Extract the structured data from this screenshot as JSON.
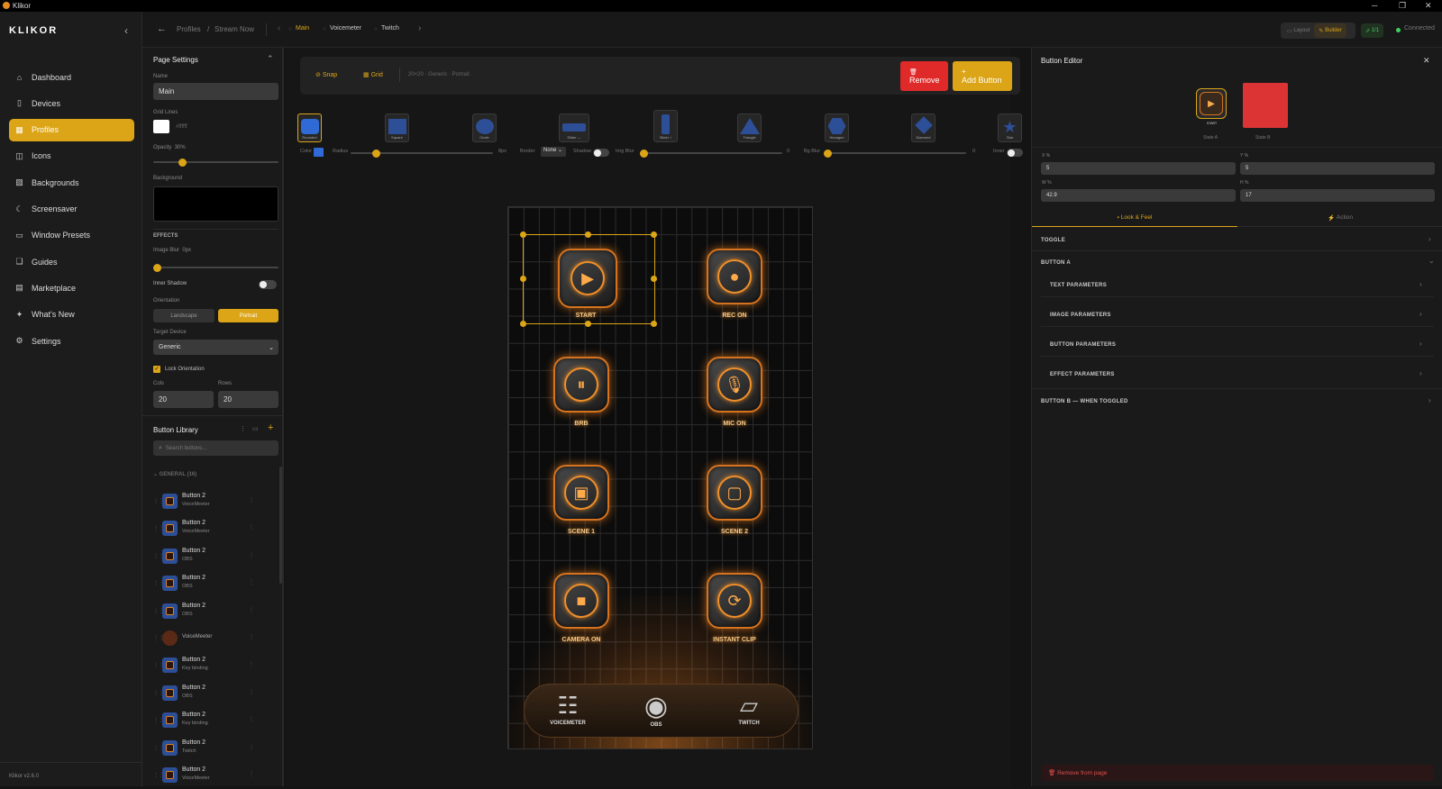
{
  "titlebar": {
    "title": "Klikor",
    "minimize": "─",
    "restore": "❐",
    "close": "✕"
  },
  "sidebar": {
    "brand": "KLIKOR",
    "collapse_icon": "‹",
    "items": [
      {
        "label": "Dashboard",
        "icon": "⌂"
      },
      {
        "label": "Devices",
        "icon": "▯"
      },
      {
        "label": "Profiles",
        "icon": "▦",
        "active": true
      },
      {
        "label": "Icons",
        "icon": "◫"
      },
      {
        "label": "Backgrounds",
        "icon": "▨"
      },
      {
        "label": "Screensaver",
        "icon": "☾"
      },
      {
        "label": "Window Presets",
        "icon": "▭"
      },
      {
        "label": "Guides",
        "icon": "❑"
      },
      {
        "label": "Marketplace",
        "icon": "▤"
      },
      {
        "label": "What's New",
        "icon": "✦"
      },
      {
        "label": "Settings",
        "icon": "⚙"
      }
    ],
    "version": "Klikor v2.6.0"
  },
  "topbar": {
    "back_icon": "←",
    "breadcrumb": [
      "Profiles",
      "/",
      "Stream Now"
    ],
    "prev_icon": "‹",
    "next_icon": "›",
    "page_tabs": [
      "Main",
      "Voicemeter",
      "Twitch"
    ],
    "mode_layout": "Layout",
    "mode_builder": "Builder",
    "page_count": "1/1",
    "status": "Connected"
  },
  "page_settings": {
    "title": "Page Settings",
    "name_label": "Name",
    "name_value": "Main",
    "grid_lines_label": "Grid Lines",
    "grid_color": "#ffffff",
    "opacity_label": "Opacity",
    "opacity_value": "30%",
    "opacity_fraction": 0.2,
    "background_label": "Background",
    "effects_label": "EFFECTS",
    "image_blur_label": "Image Blur",
    "image_blur_value": "0px",
    "inner_shadow_label": "Inner Shadow",
    "orientation_label": "Orientation",
    "landscape": "Landscape",
    "portrait": "Portrait",
    "target_device_label": "Target Device",
    "target_device_value": "Generic",
    "lock_orientation": "Lock Orientation",
    "cols_label": "Cols",
    "cols_value": "20",
    "rows_label": "Rows",
    "rows_value": "20"
  },
  "library": {
    "title": "Button Library",
    "search_placeholder": "Search buttons...",
    "group": "GENERAL (16)",
    "items": [
      {
        "name": "Button 2",
        "sub": "VoiceMeeter"
      },
      {
        "name": "Button 2",
        "sub": "VoiceMeeter"
      },
      {
        "name": "Button 2",
        "sub": "OBS"
      },
      {
        "name": "Button 2",
        "sub": "OBS"
      },
      {
        "name": "Button 2",
        "sub": "OBS"
      },
      {
        "name": "",
        "sub": "VoiceMeeter"
      },
      {
        "name": "Button 2",
        "sub": "Key binding"
      },
      {
        "name": "Button 2",
        "sub": "OBS"
      },
      {
        "name": "Button 2",
        "sub": "Key binding"
      },
      {
        "name": "Button 2",
        "sub": "Twitch"
      },
      {
        "name": "Button 2",
        "sub": "VoiceMeeter"
      }
    ]
  },
  "toolbar": {
    "snap": "Snap",
    "grid": "Grid",
    "info": "20×20 · Generic · Portrait",
    "remove": "Remove",
    "add_button": "Add Button",
    "shapes": [
      "Rounded",
      "Square",
      "Circle",
      "Slider ↔",
      "Slider ↕",
      "Triangle",
      "Hexagon",
      "Diamond",
      "Star"
    ],
    "color_label": "Color",
    "radius_label": "Radius",
    "radius_value": "8px",
    "border_label": "Border",
    "border_value": "None",
    "shadow_label": "Shadow",
    "img_blur_label": "Img Blur",
    "img_blur_value": "0",
    "bg_blur_label": "Bg Blur",
    "bg_blur_value": "0",
    "inner_label": "Inner"
  },
  "canvas": {
    "buttons": [
      {
        "label": "START",
        "glyph": "▶"
      },
      {
        "label": "REC ON",
        "glyph": "●"
      },
      {
        "label": "BRB",
        "glyph": "⏸"
      },
      {
        "label": "MIC ON",
        "glyph": "🎙"
      },
      {
        "label": "SCENE 1",
        "glyph": "▣"
      },
      {
        "label": "SCENE 2",
        "glyph": "▢"
      },
      {
        "label": "CAMERA ON",
        "glyph": "■"
      },
      {
        "label": "INSTANT CLIP",
        "glyph": "⟳"
      }
    ],
    "dock": [
      {
        "label": "VOICEMETER",
        "glyph": "☷"
      },
      {
        "label": "OBS",
        "glyph": "◉"
      },
      {
        "label": "TWITCH",
        "glyph": "▱"
      }
    ]
  },
  "editor": {
    "title": "Button Editor",
    "close": "✕",
    "state_a": "State A",
    "state_b": "State B",
    "state_a_label": "START",
    "state_b_color": "#dc3434",
    "x_label": "X %",
    "x_value": "5",
    "y_label": "Y %",
    "y_value": "5",
    "w_label": "W %",
    "w_value": "42.9",
    "h_label": "H %",
    "h_value": "17",
    "tab_look": "Look & Feel",
    "tab_action": "Action",
    "toggle": "TOGGLE",
    "button_a": "BUTTON A",
    "text_params": "TEXT PARAMETERS",
    "image_params": "IMAGE PARAMETERS",
    "button_params": "BUTTON PARAMETERS",
    "effect_params": "EFFECT PARAMETERS",
    "button_b": "BUTTON B — WHEN TOGGLED",
    "remove_from_page": "Remove from page"
  },
  "colors": {
    "accent": "#dba517",
    "danger": "#e02a2a",
    "shape_blue": "#2d4f97"
  }
}
